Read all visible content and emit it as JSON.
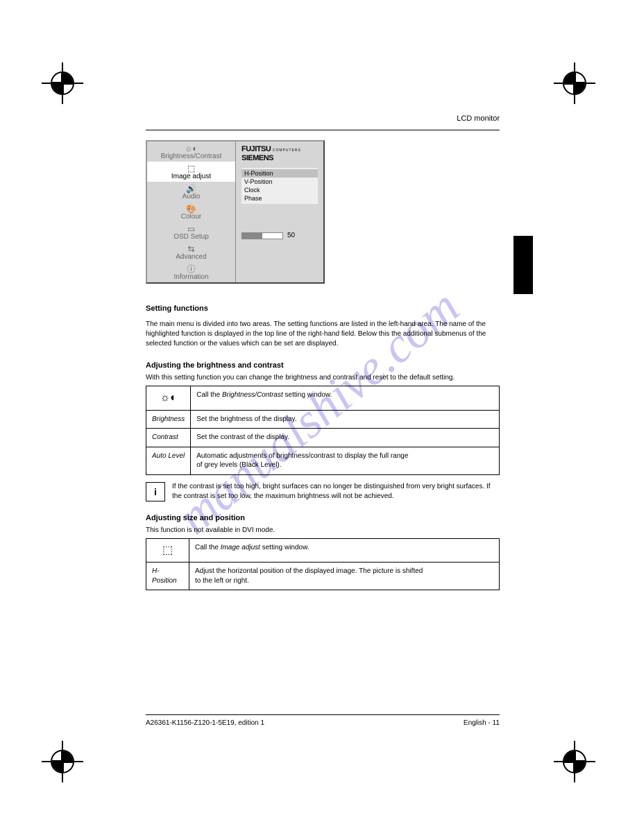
{
  "header": {
    "title": "LCD monitor"
  },
  "osd": {
    "main_menu": [
      {
        "label": "Brightness/Contrast",
        "icon": "brightness-contrast-icon",
        "glyph": "☼◐",
        "active": false
      },
      {
        "label": "Image adjust",
        "icon": "image-adjust-icon",
        "glyph": "⬚",
        "active": true
      },
      {
        "label": "Audio",
        "icon": "audio-icon",
        "glyph": "🔊",
        "active": false
      },
      {
        "label": "Colour",
        "icon": "colour-icon",
        "glyph": "🎨",
        "active": false
      },
      {
        "label": "OSD Setup",
        "icon": "osd-setup-icon",
        "glyph": "▭",
        "active": false
      },
      {
        "label": "Advanced",
        "icon": "advanced-icon",
        "glyph": "⇆",
        "active": false
      },
      {
        "label": "Information",
        "icon": "information-icon",
        "glyph": "ⓘ",
        "active": false
      }
    ],
    "brand_line1": "FUJITSU",
    "brand_small": "COMPUTERS",
    "brand_line2": "SIEMENS",
    "sub_menu": [
      {
        "label": "H-Position",
        "selected": true
      },
      {
        "label": "V-Position",
        "selected": false
      },
      {
        "label": "Clock",
        "selected": false
      },
      {
        "label": "Phase",
        "selected": false
      }
    ],
    "slider_value": "50"
  },
  "sections": {
    "set_functions_heading": "Setting functions",
    "set_functions_desc": "The main menu is divided into two areas. The setting functions are listed in the left-hand area. The name of the highlighted function is displayed in the top line of the right-hand field. Below this the additional submenus of the selected function or the values which can be set are displayed.",
    "brightness_title": "Adjusting the brightness and contrast",
    "brightness_intro": "With this setting function you can change the brightness and contrast and reset to the default setting.",
    "table_brightness": [
      {
        "icon_glyph": "☼◐",
        "icon_name": "brightness-contrast-icon",
        "text": "Call the Brightness/Contrast setting window."
      },
      {
        "plain1": "Brightness",
        "plain2": "Set the brightness of the display."
      },
      {
        "plain1": "Contrast",
        "plain2": "Set the contrast of the display."
      },
      {
        "plain1": "Auto Level",
        "plain2_lines": [
          "Automatic adjustments of brightness/contrast to display the full range",
          "of grey levels (Black Level)."
        ]
      }
    ],
    "note_icon": "i",
    "note_text": "If the contrast is set too high, bright surfaces can no longer be distinguished from very bright surfaces. If the contrast is set too low, the maximum brightness will not be achieved.",
    "image_title": "Adjusting size and position",
    "image_intro": "This function is not available in DVI mode.",
    "table_image": [
      {
        "icon_glyph": "⬚",
        "icon_name": "image-adjust-icon",
        "text": "Call the Image adjust setting window."
      },
      {
        "plain1": "H-Position",
        "plain2_lines": [
          "Adjust the horizontal position of the displayed image. The picture is shifted",
          "to the left or right."
        ]
      }
    ]
  },
  "footer": {
    "left": "A26361-K1156-Z120-1-5E19, edition 1",
    "right": "English - 11"
  },
  "watermark": "manualshive.com"
}
